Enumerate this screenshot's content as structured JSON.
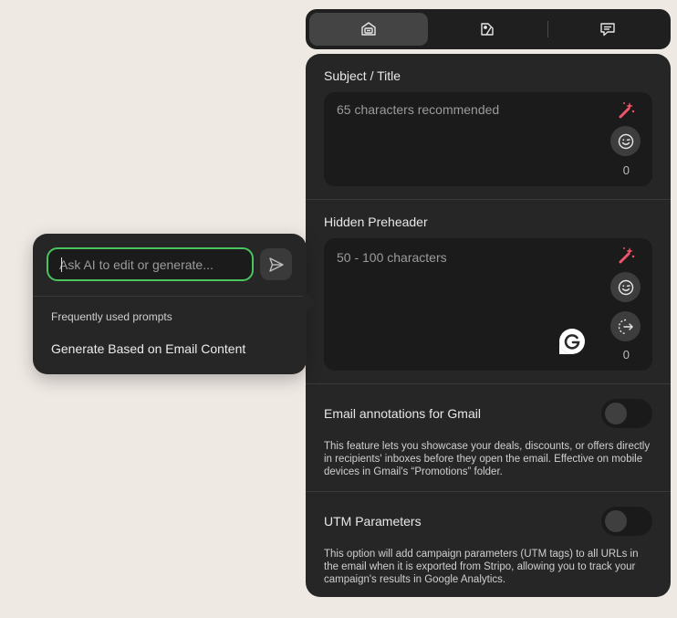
{
  "tabs": [
    {
      "icon": "email-settings-icon",
      "active": true
    },
    {
      "icon": "paint-tag-icon",
      "active": false
    },
    {
      "icon": "comment-icon",
      "active": false
    }
  ],
  "subject": {
    "label": "Subject / Title",
    "placeholder": "65 characters recommended",
    "count": "0"
  },
  "preheader": {
    "label": "Hidden Preheader",
    "placeholder": "50 - 100 characters",
    "count": "0"
  },
  "gmail": {
    "label": "Email annotations for Gmail",
    "enabled": false,
    "description": "This feature lets you showcase your deals, discounts, or offers directly in recipients' inboxes before they open the email. Effective on mobile devices in Gmail's “Promotions” folder."
  },
  "utm": {
    "label": "UTM Parameters",
    "enabled": false,
    "description": "This option will add campaign parameters (UTM tags) to all URLs in the email when it is exported from Stripo, allowing you to track your campaign's results in Google Analytics."
  },
  "ai": {
    "placeholder": "Ask AI to edit or generate...",
    "value": "",
    "subtitle": "Frequently used prompts",
    "prompts": [
      "Generate Based on Email Content"
    ]
  },
  "colors": {
    "accent_green": "#49c45e",
    "wand_pink": "#f2546b",
    "panel_bg": "#262626",
    "page_bg": "#efe9e4"
  }
}
